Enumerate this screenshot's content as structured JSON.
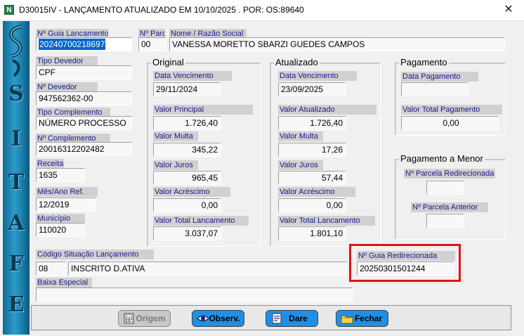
{
  "window": {
    "icon_text": "N",
    "title": "D30015IV - LANÇAMENTO ATUALIZADO EM 10/10/2025 .  POR: OS:89640",
    "close": "✕"
  },
  "sidebar": {
    "letters": [
      "S",
      "I",
      "T",
      "A",
      "F",
      "E"
    ]
  },
  "fields": {
    "guia_label": "Nº Guia Lancamento",
    "guia_value": "20240700218697",
    "parc_label": "Nº Parc",
    "parc_value": "00",
    "nome_label": "Nome / Razão Social",
    "nome_value": "VANESSA MORETTO SBARZI GUEDES CAMPOS",
    "tipo_devedor_label": "Tipo Devedor",
    "tipo_devedor_value": "CPF",
    "devedor_label": "Nº Devedor",
    "devedor_value": "947562362-00",
    "tipo_compl_label": "Tipo Complemento",
    "tipo_compl_value": "NÚMERO PROCESSO",
    "compl_label": "Nº Complemento",
    "compl_value": "20016312202482",
    "receita_label": "Receita",
    "receita_value": "1635",
    "mesano_label": "Mês/Ano Ref.",
    "mesano_value": "12/2019",
    "municipio_label": "Município",
    "municipio_value": "110020",
    "situacao_label": "Código Situação Lançamento",
    "situacao_code": "08",
    "situacao_desc": "INSCRITO D.ATIVA",
    "baixa_label": "Baixa Especial",
    "baixa_value": "",
    "redirecionada_label": "Nº Guia Redirecionada",
    "redirecionada_value": "20250301501244"
  },
  "original": {
    "title": "Original",
    "venc_label": "Data Vencimento",
    "venc_value": "29/11/2024",
    "principal_label": "Valor Principal",
    "principal_value": "1.726,40",
    "multa_label": "Valor Multa",
    "multa_value": "345,22",
    "juros_label": "Valor Juros",
    "juros_value": "965,45",
    "acrescimo_label": "Valor Acréscimo",
    "acrescimo_value": "0,00",
    "total_label": "Valor Total Lancamento",
    "total_value": "3.037,07"
  },
  "atualizado": {
    "title": "Atualizado",
    "venc_label": "Data Vencimento",
    "venc_value": "23/09/2025",
    "principal_label": "Valor Atualizado",
    "principal_value": "1.726,40",
    "multa_label": "Valor Multa",
    "multa_value": "17,26",
    "juros_label": "Valor Juros",
    "juros_value": "57,44",
    "acrescimo_label": "Valor Acréscimo",
    "acrescimo_value": "0,00",
    "total_label": "Valor Total Lancamento",
    "total_value": "1.801,10"
  },
  "pagamento": {
    "title": "Pagamento",
    "data_label": "Data Pagamento",
    "data_value": "",
    "total_label": "Valor Total Pagamento",
    "total_value": "0,00"
  },
  "pagamento_menor": {
    "title": "Pagamento a Menor",
    "redir_label": "Nº Parcela Redirecionada",
    "redir_value": "",
    "anterior_label": "Nº Parcela Anterior",
    "anterior_value": ""
  },
  "buttons": {
    "origem": "Origem",
    "observ": "Observ.",
    "dare": "Dare",
    "fechar": "Fechar"
  },
  "colors": {
    "label_text": "#1a1a8c",
    "label_bg": "#d0d0d0",
    "highlight": "#e0121c",
    "sidebar": "#1d84b3"
  }
}
